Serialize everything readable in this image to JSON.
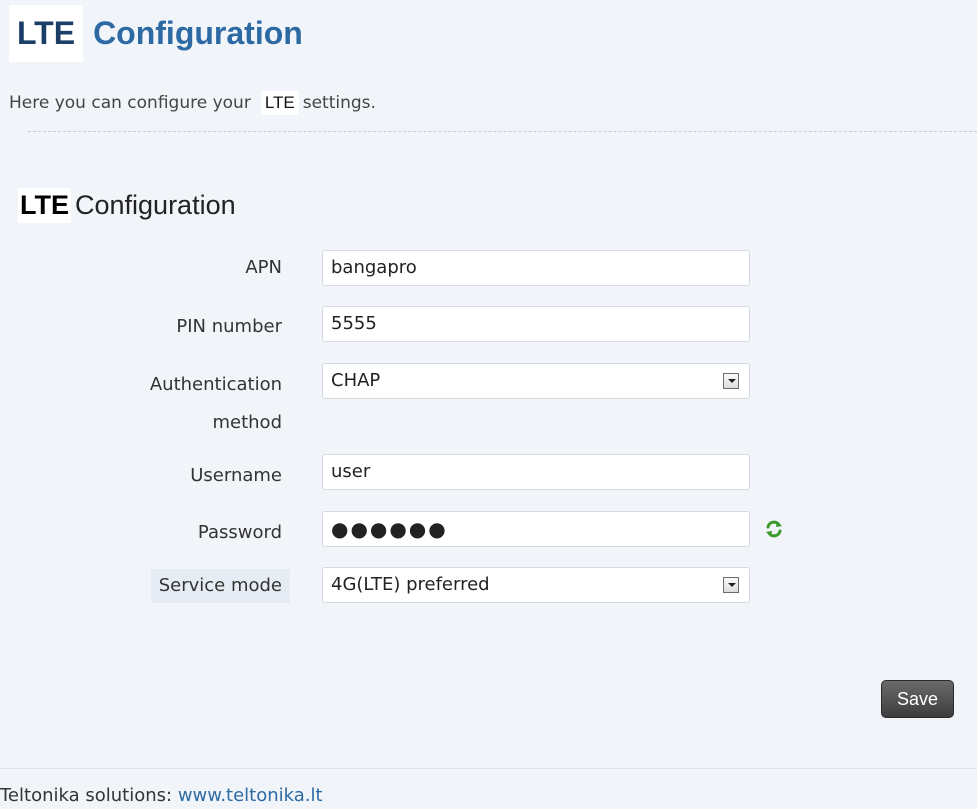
{
  "header": {
    "title_lte": "LTE",
    "title_rest": "Configuration"
  },
  "description": {
    "before": "Here you can configure your",
    "lte": "LTE",
    "after": "settings."
  },
  "section": {
    "title_lte": "LTE",
    "title_rest": "Configuration"
  },
  "form": {
    "apn": {
      "label": "APN",
      "value": "bangapro"
    },
    "pin": {
      "label": "PIN number",
      "value": "5555"
    },
    "auth": {
      "label_line1": "Authentication",
      "label_line2": "method",
      "value": "CHAP"
    },
    "username": {
      "label": "Username",
      "value": "user"
    },
    "password": {
      "label": "Password",
      "value": "●●●●●●"
    },
    "service_mode": {
      "label": "Service mode",
      "value": "4G(LTE) preferred"
    }
  },
  "actions": {
    "save_label": "Save"
  },
  "footer": {
    "text": "Teltonika solutions:",
    "link": "www.teltonika.lt"
  },
  "icons": {
    "select_arrow": "chevron-down-icon",
    "refresh": "refresh-icon"
  },
  "colors": {
    "background": "#f1f4f9",
    "title_blue": "#2d6aa3",
    "save_button": "#4a4a4a",
    "refresh_green": "#3a9a2a"
  }
}
